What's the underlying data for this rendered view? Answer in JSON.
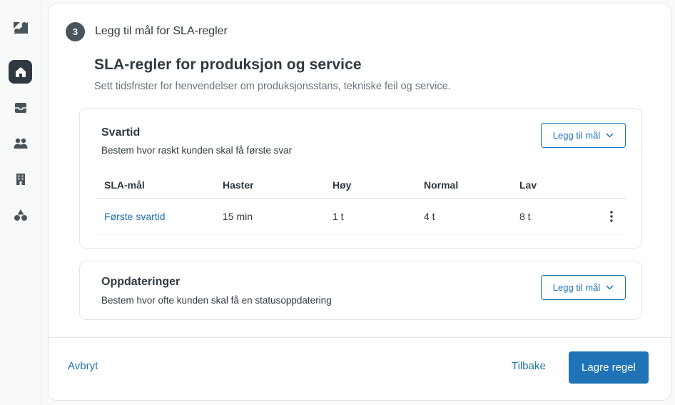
{
  "sidebar": {
    "items": [
      {
        "icon": "zendesk-logo-icon"
      },
      {
        "icon": "home-icon",
        "active": true
      },
      {
        "icon": "inbox-icon"
      },
      {
        "icon": "users-icon"
      },
      {
        "icon": "organization-icon"
      },
      {
        "icon": "shapes-icon"
      }
    ]
  },
  "step": {
    "number": "3",
    "title": "Legg til mål for SLA-regler"
  },
  "page": {
    "title": "SLA-regler for produksjon og service",
    "subtitle": "Sett tidsfrister for henvendelser om produksjonsstans, tekniske feil og service."
  },
  "cards": {
    "response": {
      "title": "Svartid",
      "description": "Bestem hvor raskt kunden skal få første svar",
      "add_label": "Legg til mål",
      "columns": [
        "SLA-mål",
        "Haster",
        "Høy",
        "Normal",
        "Lav"
      ],
      "rows": [
        {
          "name": "Første svartid",
          "urgent": "15 min",
          "high": "1 t",
          "normal": "4 t",
          "low": "8 t"
        }
      ]
    },
    "updates": {
      "title": "Oppdateringer",
      "description": "Bestem hvor ofte kunden skal få en statusoppdatering",
      "add_label": "Legg til mål"
    }
  },
  "footer": {
    "cancel_label": "Avbryt",
    "back_label": "Tilbake",
    "save_label": "Lagre regel"
  },
  "colors": {
    "accent": "#1f73b7",
    "sidebar_active": "#2f3941",
    "text": "#2f3941",
    "muted": "#68737d"
  }
}
